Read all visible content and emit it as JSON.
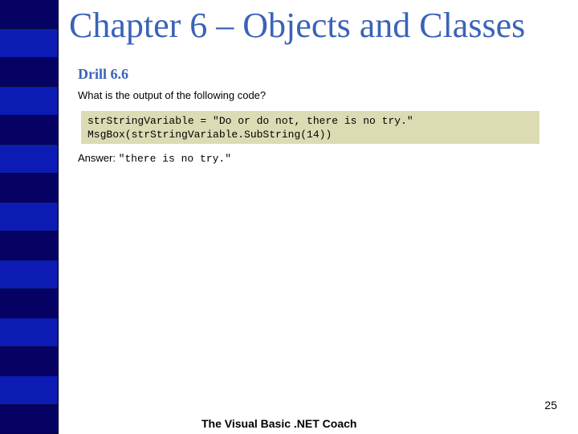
{
  "slide": {
    "title": "Chapter 6 – Objects and Classes",
    "heading": "Drill 6.6",
    "question": "What is the output of the following code?",
    "code_lines": [
      "strStringVariable = \"Do or do not, there is no try.\"",
      "MsgBox(strStringVariable.SubString(14))"
    ],
    "answer_label": "Answer: ",
    "answer_value": "\"there is no try.\"",
    "page_number": "25",
    "footer": "The Visual Basic .NET Coach"
  },
  "theme": {
    "title_color": "#3a63b8",
    "stripe_dark": "#060264",
    "stripe_light": "#0c1bb4",
    "code_background": "#dcdcb4"
  },
  "sidebar": {
    "stripes": [
      "dark",
      "light",
      "dark",
      "light",
      "dark",
      "light",
      "dark",
      "light",
      "dark",
      "light",
      "dark",
      "light",
      "dark",
      "light",
      "dark"
    ]
  }
}
